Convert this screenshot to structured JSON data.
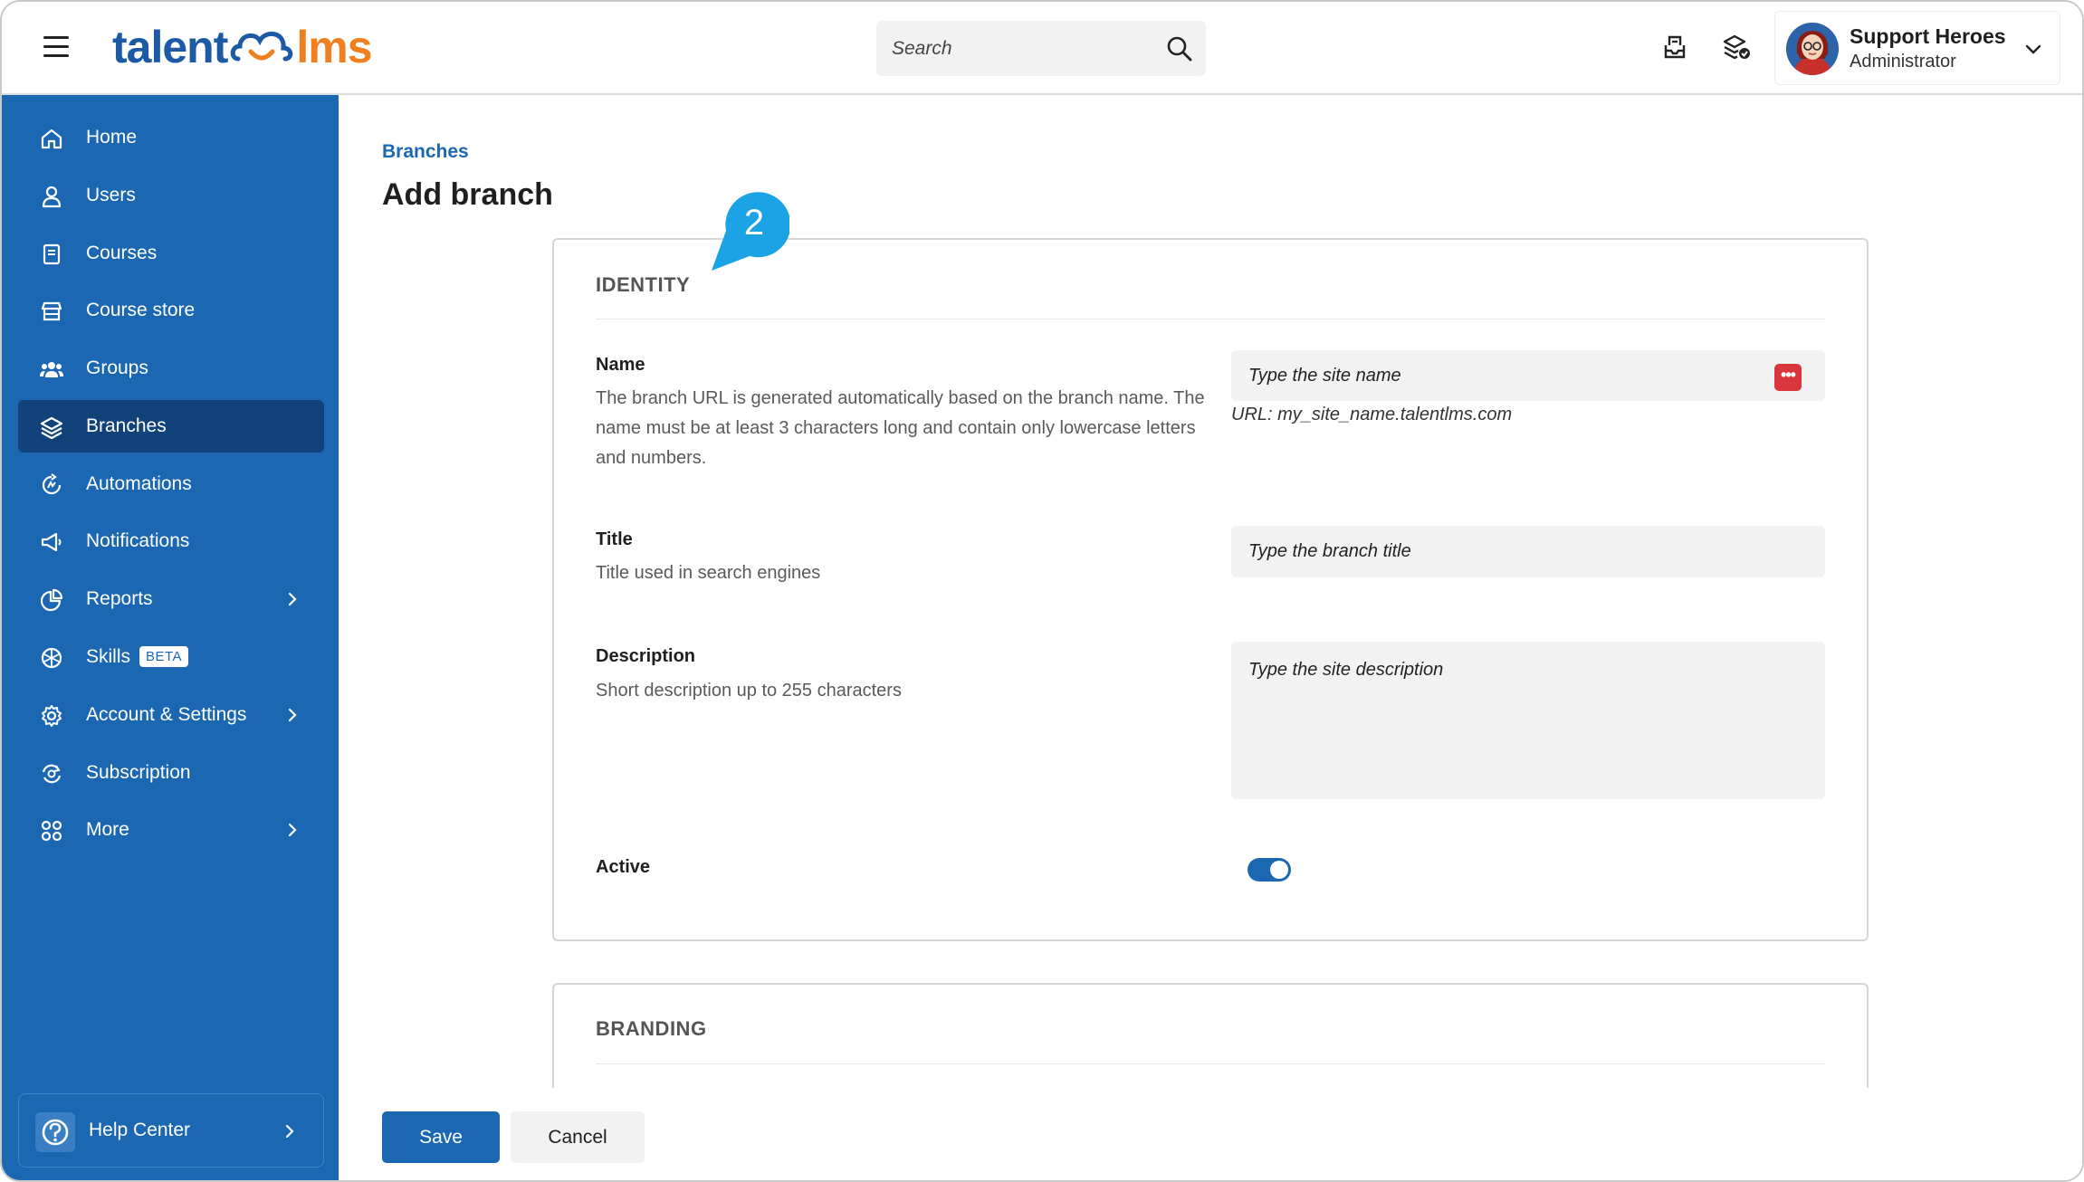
{
  "header": {
    "logo_left": "talent",
    "logo_right": "lms",
    "search_placeholder": "Search",
    "user": {
      "name": "Support Heroes",
      "role": "Administrator"
    }
  },
  "sidebar": {
    "items": [
      {
        "label": "Home",
        "icon": "home-icon"
      },
      {
        "label": "Users",
        "icon": "user-icon"
      },
      {
        "label": "Courses",
        "icon": "book-icon"
      },
      {
        "label": "Course store",
        "icon": "store-icon"
      },
      {
        "label": "Groups",
        "icon": "groups-icon"
      },
      {
        "label": "Branches",
        "icon": "layers-icon",
        "active": true
      },
      {
        "label": "Automations",
        "icon": "automation-icon"
      },
      {
        "label": "Notifications",
        "icon": "megaphone-icon"
      },
      {
        "label": "Reports",
        "icon": "pie-chart-icon",
        "has_submenu": true
      },
      {
        "label": "Skills",
        "icon": "skills-icon",
        "badge": "BETA"
      },
      {
        "label": "Account & Settings",
        "icon": "gear-icon",
        "has_submenu": true
      },
      {
        "label": "Subscription",
        "icon": "subscription-icon"
      },
      {
        "label": "More",
        "icon": "grid-icon",
        "has_submenu": true
      }
    ],
    "help_center": "Help Center"
  },
  "main": {
    "breadcrumb": "Branches",
    "title": "Add branch",
    "callout_number": "2",
    "identity": {
      "header": "IDENTITY",
      "name_label": "Name",
      "name_help": "The branch URL is generated automatically based on the branch name. The name must be at least 3 characters long and contain only lowercase letters and numbers.",
      "name_placeholder": "Type the site name",
      "url_hint": "URL: my_site_name.talentlms.com",
      "title_label": "Title",
      "title_help": "Title used in search engines",
      "title_placeholder": "Type the branch title",
      "description_label": "Description",
      "description_help": "Short description up to 255 characters",
      "description_placeholder": "Type the site description",
      "active_label": "Active",
      "active_value": true
    },
    "branding": {
      "header": "BRANDING"
    }
  },
  "footer": {
    "save": "Save",
    "cancel": "Cancel"
  },
  "colors": {
    "brand_blue": "#1c67b2",
    "sidebar_active": "#11427a",
    "logo_orange": "#f07f1f",
    "callout": "#1ba3e6",
    "alert_red": "#d9363e"
  }
}
